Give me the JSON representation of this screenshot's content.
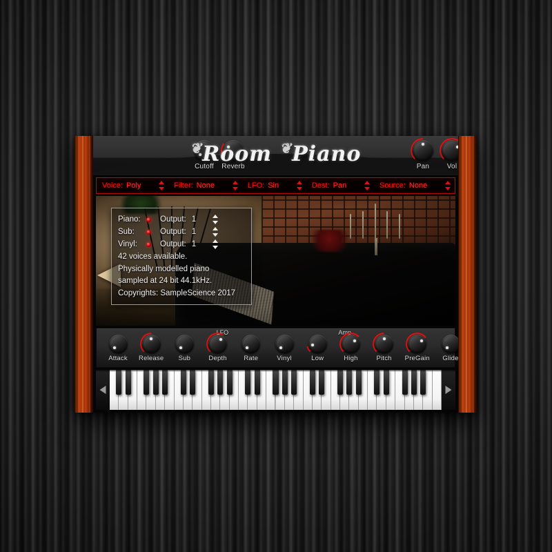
{
  "window": {
    "title": "Room Piano",
    "logo_word1": "Room",
    "logo_word2": "Piano"
  },
  "colors": {
    "accent_red": "#e01212",
    "led_red": "#ff2b2b",
    "wood_orange": "#d84a12",
    "panel_dark": "#2b2b2b",
    "text_light": "#efefef"
  },
  "top_knobs": [
    {
      "label": "Cutoff",
      "value": 0,
      "arc": false
    },
    {
      "label": "Reverb",
      "value": 30,
      "arc": true
    },
    {
      "label": "Pan",
      "value": 50,
      "arc": true
    },
    {
      "label": "Vol",
      "value": 72,
      "arc": true
    }
  ],
  "selector_bar": [
    {
      "name": "voice",
      "label": "Voice:",
      "value": "Poly"
    },
    {
      "name": "filter",
      "label": "Filter:",
      "value": "None"
    },
    {
      "name": "lfo",
      "label": "LFO:",
      "value": "Sin"
    },
    {
      "name": "dest",
      "label": "Dest:",
      "value": "Pan"
    },
    {
      "name": "source",
      "label": "Source:",
      "value": "None"
    }
  ],
  "info_panel": {
    "rows": [
      {
        "label": "Piano:",
        "led": "on",
        "output_label": "Output:",
        "output_value": "1"
      },
      {
        "label": "Sub:",
        "led": "on",
        "output_label": "Output:",
        "output_value": "1"
      },
      {
        "label": "Vinyl:",
        "led": "on",
        "output_label": "Output:",
        "output_value": "1"
      }
    ],
    "lines": [
      "42 voices available.",
      "Physically modelled piano",
      "sampled at 24 bit 44.1kHz.",
      "Copyrights: SampleScience 2017"
    ]
  },
  "bottom_section_labels": [
    {
      "name": "lfo-group",
      "text": "LFO"
    },
    {
      "name": "amp-group",
      "text": "Amp"
    }
  ],
  "bottom_knobs": [
    {
      "label": "Attack",
      "value": 0,
      "arc": false
    },
    {
      "label": "Release",
      "value": 50,
      "arc": true
    },
    {
      "label": "Sub",
      "value": 0,
      "arc": false
    },
    {
      "label": "Depth",
      "value": 62,
      "arc": true
    },
    {
      "label": "Rate",
      "value": 0,
      "arc": false
    },
    {
      "label": "Vinyl",
      "value": 0,
      "arc": false
    },
    {
      "label": "Low",
      "value": 12,
      "arc": true
    },
    {
      "label": "High",
      "value": 68,
      "arc": true
    },
    {
      "label": "Pitch",
      "value": 50,
      "arc": true
    },
    {
      "label": "PreGain",
      "value": 70,
      "arc": true
    },
    {
      "label": "Glide",
      "value": 0,
      "arc": false
    }
  ],
  "keyboard": {
    "prev_arrow": "◀",
    "next_arrow": "▶",
    "white_key_count": 36
  },
  "preset_prev_arrow": "◀"
}
